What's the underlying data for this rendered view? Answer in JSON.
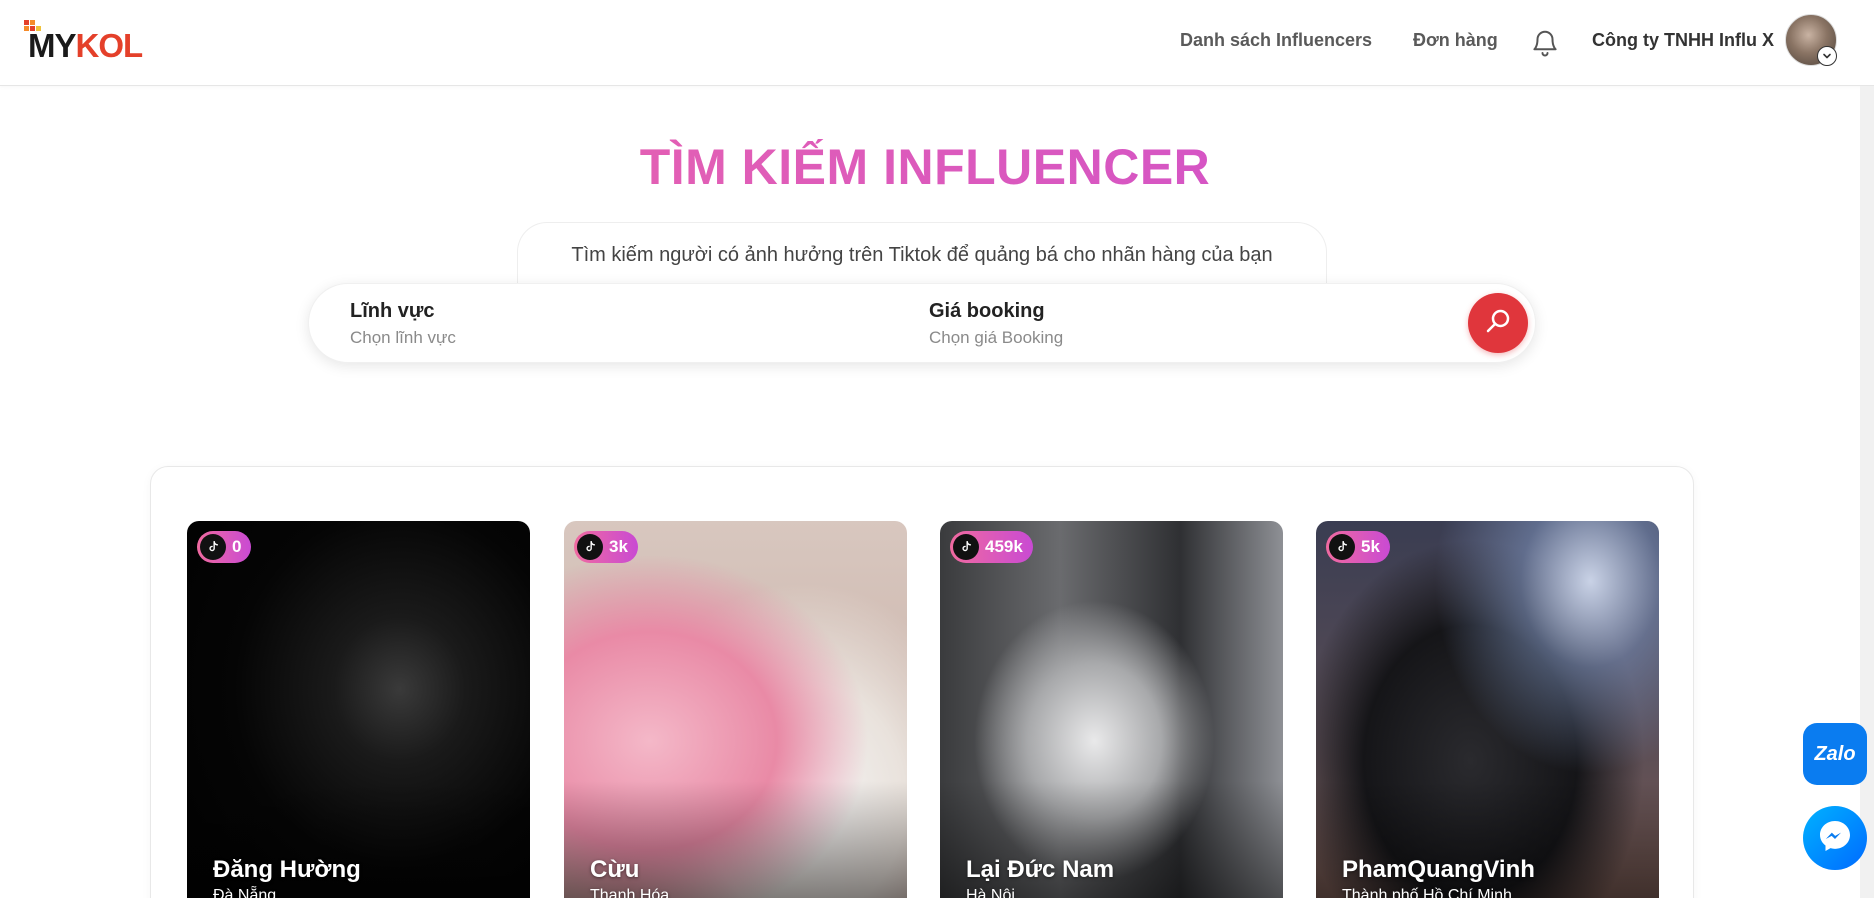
{
  "header": {
    "logo_my": "MY",
    "logo_kol": "KOL",
    "nav_influencers": "Danh sách Influencers",
    "nav_orders": "Đơn hàng",
    "company_name": "Công ty TNHH Influ X"
  },
  "hero": {
    "title": "TÌM KIẾM INFLUENCER",
    "subtitle": "Tìm kiếm người có ảnh hưởng trên Tiktok để quảng bá cho nhãn hàng của bạn",
    "field_category_label": "Lĩnh vực",
    "field_category_placeholder": "Chọn lĩnh vực",
    "field_price_label": "Giá booking",
    "field_price_placeholder": "Chọn giá Booking"
  },
  "influencers": [
    {
      "followers": "0",
      "name": "Đăng Hường",
      "location": "Đà Nẵng"
    },
    {
      "followers": "3k",
      "name": "Cừu",
      "location": "Thanh Hóa"
    },
    {
      "followers": "459k",
      "name": "Lại Đức Nam",
      "location": "Hà Nội"
    },
    {
      "followers": "5k",
      "name": "PhamQuangVinh",
      "location": "Thành phố Hồ Chí Minh"
    }
  ],
  "chat": {
    "zalo_label": "Zalo"
  },
  "colors": {
    "accent_pink": "#f16aa2",
    "accent_purple": "#c74ad6",
    "search_red": "#e0363c",
    "logo_red": "#e4402a",
    "zalo_blue": "#0a7cf0"
  }
}
